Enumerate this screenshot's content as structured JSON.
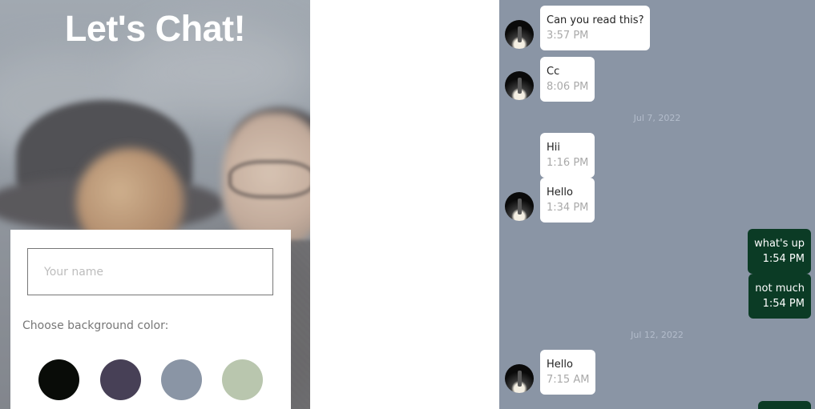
{
  "start_screen": {
    "title": "Let's Chat!",
    "name_input": {
      "value": "",
      "placeholder": "Your name"
    },
    "color_label": "Choose background color:",
    "color_options": [
      {
        "name": "black",
        "color": "#090C08"
      },
      {
        "name": "purple",
        "color": "#474056"
      },
      {
        "name": "grey",
        "color": "#8A95A5"
      },
      {
        "name": "green",
        "color": "#B9C6AE"
      }
    ]
  },
  "chat": {
    "background_color": "#8A95A5",
    "incoming_bubble_color": "#FFFFFF",
    "outgoing_bubble_color": "#0B3B25",
    "items": [
      {
        "kind": "message",
        "direction": "in",
        "avatar": true,
        "text": "Can you read this?",
        "time": "3:57 PM"
      },
      {
        "kind": "message",
        "direction": "in",
        "avatar": true,
        "text": "Cc",
        "time": "8:06 PM"
      },
      {
        "kind": "day",
        "label": "Jul 7, 2022"
      },
      {
        "kind": "message",
        "direction": "in",
        "avatar": false,
        "text": "Hii",
        "time": "1:16 PM"
      },
      {
        "kind": "message",
        "direction": "in",
        "avatar": true,
        "text": "Hello",
        "time": "1:34 PM"
      },
      {
        "kind": "message",
        "direction": "out",
        "text": "what's up",
        "time": "1:54 PM"
      },
      {
        "kind": "message",
        "direction": "out",
        "text": "not much",
        "time": "1:54 PM"
      },
      {
        "kind": "day",
        "label": "Jul 12, 2022"
      },
      {
        "kind": "message",
        "direction": "in",
        "avatar": true,
        "text": "Hello",
        "time": "7:15 AM"
      },
      {
        "kind": "message",
        "direction": "out",
        "text": "",
        "time": ""
      }
    ]
  }
}
